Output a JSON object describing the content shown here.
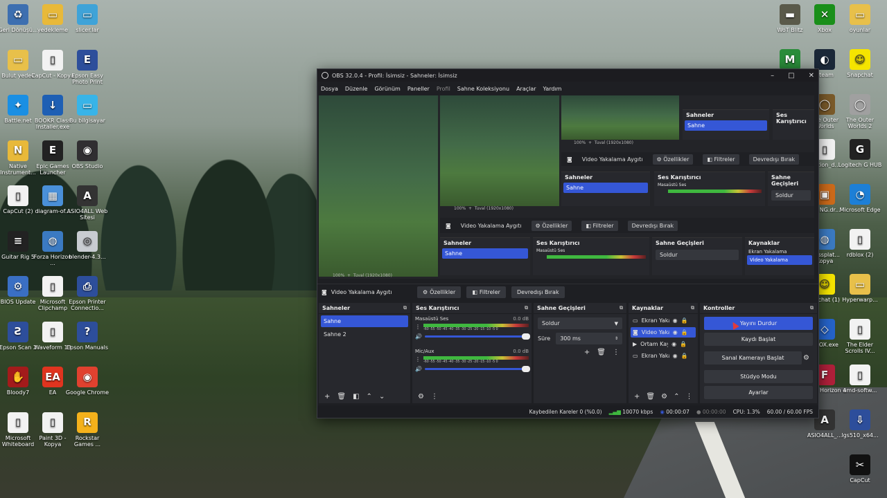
{
  "desktop": {
    "icons_left": [
      {
        "label": "Geri Dönüşü...",
        "icon": "recycle-bin-icon",
        "color": "#3d6fb0",
        "glyph": "♻"
      },
      {
        "label": "yedekleme",
        "icon": "folder-icon",
        "color": "#e8b93a",
        "glyph": "▭"
      },
      {
        "label": "slicer.lar",
        "icon": "folder-icon",
        "color": "#3fa3d8",
        "glyph": "▭"
      },
      {
        "label": "Bulut yedek",
        "icon": "folder-icon",
        "color": "#e8c04a",
        "glyph": "▭"
      },
      {
        "label": "CapCut - Kopya",
        "icon": "document-icon",
        "color": "#f2f2f2",
        "glyph": "▯"
      },
      {
        "label": "Epson Easy Photo Print",
        "icon": "epson-icon",
        "color": "#2d4e9b",
        "glyph": "E"
      },
      {
        "label": "Battle.net",
        "icon": "battlenet-icon",
        "color": "#1a8fe3",
        "glyph": "✦"
      },
      {
        "label": "BOOKR Class Installer.exe",
        "icon": "download-icon",
        "color": "#1e5fb4",
        "glyph": "↓"
      },
      {
        "label": "Bu bilgisayar",
        "icon": "monitor-icon",
        "color": "#38b4e8",
        "glyph": "▭"
      },
      {
        "label": "Native Instrument...",
        "icon": "folder-icon",
        "color": "#e8b93a",
        "glyph": "N"
      },
      {
        "label": "Epic Games Launcher",
        "icon": "epic-icon",
        "color": "#222222",
        "glyph": "E"
      },
      {
        "label": "OBS Studio",
        "icon": "obs-icon",
        "color": "#302e31",
        "glyph": "◉"
      },
      {
        "label": "CapCut (2)",
        "icon": "document-icon",
        "color": "#f2f2f2",
        "glyph": "▯"
      },
      {
        "label": "diagram-of...",
        "icon": "image-icon",
        "color": "#4a90d9",
        "glyph": "▦"
      },
      {
        "label": "ASIO4ALL Web Sitesi",
        "icon": "asio-icon",
        "color": "#333333",
        "glyph": "A"
      },
      {
        "label": "Guitar Rig 5",
        "icon": "guitar-rig-icon",
        "color": "#222222",
        "glyph": "≡"
      },
      {
        "label": "Forza Horizon ...",
        "icon": "globe-icon",
        "color": "#3b7ac2",
        "glyph": "◍"
      },
      {
        "label": "blender-4.3...",
        "icon": "disc-icon",
        "color": "#c8ccd1",
        "glyph": "◎"
      },
      {
        "label": "BIOS Update",
        "icon": "bios-icon",
        "color": "#3a6fc4",
        "glyph": "⚙"
      },
      {
        "label": "Microsoft Clipchamp",
        "icon": "document-icon",
        "color": "#f2f2f2",
        "glyph": "▯"
      },
      {
        "label": "Epson Printer Connectio...",
        "icon": "printer-icon",
        "color": "#2d4e9b",
        "glyph": "⎙"
      },
      {
        "label": "Epson Scan 2",
        "icon": "scanner-icon",
        "color": "#2d4e9b",
        "glyph": "Ƨ"
      },
      {
        "label": "Waveform 13",
        "icon": "document-icon",
        "color": "#f2f2f2",
        "glyph": "▯"
      },
      {
        "label": "Epson Manuals",
        "icon": "manual-icon",
        "color": "#2d4e9b",
        "glyph": "?"
      },
      {
        "label": "Bloody7",
        "icon": "bloody-icon",
        "color": "#a31b1b",
        "glyph": "✋"
      },
      {
        "label": "EA",
        "icon": "ea-icon",
        "color": "#e0341f",
        "glyph": "EA"
      },
      {
        "label": "Google Chrome",
        "icon": "chrome-icon",
        "color": "#e0412f",
        "glyph": "◉"
      },
      {
        "label": "Microsoft Whiteboard",
        "icon": "document-icon",
        "color": "#f2f2f2",
        "glyph": "▯"
      },
      {
        "label": "Paint 3D - Kopya",
        "icon": "document-icon",
        "color": "#f2f2f2",
        "glyph": "▯"
      },
      {
        "label": "Rockstar Games ...",
        "icon": "rockstar-icon",
        "color": "#f4b11b",
        "glyph": "R"
      }
    ],
    "icons_right": [
      {
        "label": "WoT Blitz",
        "icon": "tank-icon",
        "color": "#5a5a4a",
        "glyph": "▬"
      },
      {
        "label": "Xbox",
        "icon": "xbox-icon",
        "color": "#1a8f1a",
        "glyph": "✕"
      },
      {
        "label": "oyunlar",
        "icon": "folder-icon",
        "color": "#e8c04a",
        "glyph": "▭"
      },
      {
        "label": "...",
        "icon": "app-icon",
        "color": "#2a8c3a",
        "glyph": "M"
      },
      {
        "label": "Steam",
        "icon": "steam-icon",
        "color": "#1b2838",
        "glyph": "◐"
      },
      {
        "label": "Snapchat",
        "icon": "snapchat-icon",
        "color": "#f5e400",
        "glyph": "☺"
      },
      {
        "label": "The Outer Worlds",
        "icon": "outer-worlds-icon",
        "color": "#7a5a2a",
        "glyph": "◯"
      },
      {
        "label": "The Outer Worlds 2",
        "icon": "outer-worlds-icon",
        "color": "#a0a0a0",
        "glyph": "◯"
      },
      {
        "label": "...ction_d...",
        "icon": "document-icon",
        "color": "#f2f2f2",
        "glyph": "▯"
      },
      {
        "label": "Logitech G HUB",
        "icon": "logitech-icon",
        "color": "#222222",
        "glyph": "G"
      },
      {
        "label": "...mNG.dr...",
        "icon": "app-icon",
        "color": "#cc6a1a",
        "glyph": "▣"
      },
      {
        "label": "Microsoft Edge",
        "icon": "edge-icon",
        "color": "#1d7fd6",
        "glyph": "◔"
      },
      {
        "label": "...ossplat... Kopya",
        "icon": "globe-icon",
        "color": "#3b7ac2",
        "glyph": "◍"
      },
      {
        "label": "rdblox (2)",
        "icon": "document-icon",
        "color": "#f2f2f2",
        "glyph": "▯"
      },
      {
        "label": "...pchat (1)",
        "icon": "snapchat-icon",
        "color": "#f5e400",
        "glyph": "☺"
      },
      {
        "label": "Hyperwarp...",
        "icon": "folder-icon",
        "color": "#e8c04a",
        "glyph": "▭"
      },
      {
        "label": "...LOX.exe",
        "icon": "roblox-icon",
        "color": "#2563c9",
        "glyph": "◇"
      },
      {
        "label": "The Elder Scrolls IV...",
        "icon": "document-icon",
        "color": "#f2f2f2",
        "glyph": "▯"
      },
      {
        "label": "Forza Horizon 4",
        "icon": "forza-icon",
        "color": "#b0203a",
        "glyph": "F"
      },
      {
        "label": "amd-softw...",
        "icon": "document-icon",
        "color": "#f2f2f2",
        "glyph": "▯"
      },
      {
        "label": "ASIO4ALL_...",
        "icon": "asio-icon",
        "color": "#333333",
        "glyph": "A"
      },
      {
        "label": "lgs510_x64...",
        "icon": "installer-icon",
        "color": "#2d4e9b",
        "glyph": "⇩"
      },
      {
        "label": "CapCut",
        "icon": "capcut-icon",
        "color": "#111111",
        "glyph": "✂"
      }
    ]
  },
  "obs": {
    "title": "OBS 32.0.4 - Profil: İsimsiz - Sahneler: İsimsiz",
    "menu": [
      "Dosya",
      "Düzenle",
      "Görünüm",
      "Paneller",
      "Profil",
      "Sahne Koleksiyonu",
      "Araçlar",
      "Yardım"
    ],
    "preview": {
      "zoom": "100%",
      "canvas": "Tuval (1920x1080)"
    },
    "toolbar": {
      "source_name": "Video Yakalama Aygıtı",
      "properties": "Özellikler",
      "filters": "Filtreler",
      "deactivate": "Devredışı Bırak"
    },
    "docks": {
      "scenes": {
        "title": "Sahneler",
        "items": [
          "Sahne",
          "Sahne 2"
        ],
        "active_index": 0
      },
      "mixer": {
        "title": "Ses Karıştırıcı",
        "channels": [
          {
            "name": "Masaüstü Ses",
            "db": "0.0 dB",
            "level": 0.92
          },
          {
            "name": "Mic/Aux",
            "db": "0.0 dB",
            "level": 0.92
          }
        ],
        "scale": "-60 -55 -50 -45 -40 -35 -30 -25 -20 -15 -10 -5 0"
      },
      "transitions": {
        "title": "Sahne Geçişleri",
        "selected": "Soldur",
        "duration_label": "Süre",
        "duration_value": "300 ms"
      },
      "sources": {
        "title": "Kaynaklar",
        "items": [
          {
            "name": "Ekran Yakalama",
            "icon": "monitor-icon",
            "active": false
          },
          {
            "name": "Video Yakalama",
            "icon": "camera-icon",
            "active": true
          },
          {
            "name": "Ortam Kaynağı",
            "icon": "play-icon",
            "active": false
          },
          {
            "name": "Ekran Yakalama",
            "icon": "monitor-icon",
            "active": false
          }
        ]
      },
      "controls": {
        "title": "Kontroller",
        "stop_stream": "Yayını Durdur",
        "start_record": "Kaydı Başlat",
        "start_virtual_cam": "Sanal Kamerayı Başlat",
        "studio_mode": "Stüdyo Modu",
        "settings": "Ayarlar"
      }
    },
    "status": {
      "dropped_frames": "Kaybedilen Kareler 0 (%0.0)",
      "bitrate": "10070 kbps",
      "stream_time": "00:00:07",
      "record_time": "00:00:00",
      "cpu": "CPU: 1.3%",
      "fps": "60.00 / 60.00 FPS"
    },
    "accent": "#3557d6"
  }
}
